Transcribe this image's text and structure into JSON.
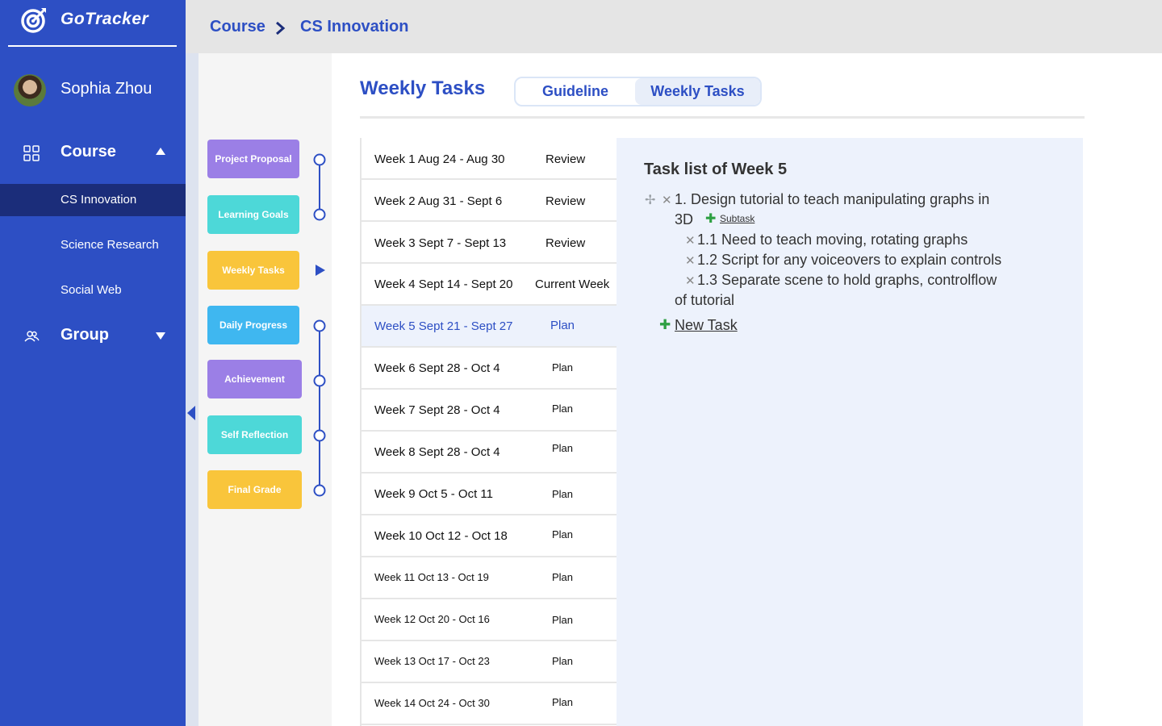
{
  "app": {
    "name": "GoTracker"
  },
  "user": {
    "name": "Sophia Zhou"
  },
  "sidebar": {
    "course": {
      "label": "Course"
    },
    "course_items": [
      "CS Innovation",
      "Science Research",
      "Social Web"
    ],
    "group": {
      "label": "Group"
    }
  },
  "breadcrumb": {
    "items": [
      "Course",
      "CS Innovation"
    ]
  },
  "stages": [
    {
      "label": "Project Proposal",
      "color": "#9b7fe6"
    },
    {
      "label": "Learning Goals",
      "color": "#4dd8d8"
    },
    {
      "label": "Weekly Tasks",
      "color": "#f9c53b"
    },
    {
      "label": "Daily Progress",
      "color": "#3fb7f0"
    },
    {
      "label": "Achievement",
      "color": "#9b7fe6"
    },
    {
      "label": "Self Reflection",
      "color": "#4dd8d8"
    },
    {
      "label": "Final Grade",
      "color": "#f9c53b"
    }
  ],
  "main": {
    "title": "Weekly Tasks",
    "tabs": [
      "Guideline",
      "Weekly Tasks"
    ]
  },
  "weeks": [
    {
      "label": "Week 1  Aug 24 - Aug 30",
      "status": "Review"
    },
    {
      "label": "Week 2  Aug 31 - Sept 6",
      "status": "Review"
    },
    {
      "label": "Week 3  Sept 7 - Sept 13",
      "status": "Review"
    },
    {
      "label": "Week 4  Sept 14 - Sept 20",
      "status": "Current Week"
    },
    {
      "label": "Week 5  Sept 21 - Sept 27",
      "status": "Plan"
    },
    {
      "label": "Week 6  Sept 28 - Oct 4",
      "status": "Plan"
    },
    {
      "label": "Week 7  Sept 28 - Oct 4",
      "status": "Plan"
    },
    {
      "label": "Week 8  Sept 28 - Oct 4",
      "status": "Plan"
    },
    {
      "label": "Week 9  Oct 5 - Oct 11",
      "status": "Plan"
    },
    {
      "label": "Week 10  Oct 12 - Oct 18",
      "status": "Plan"
    },
    {
      "label": "Week 11  Oct 13 - Oct 19",
      "status": "Plan"
    },
    {
      "label": "Week 12  Oct 20 - Oct 16",
      "status": "Plan"
    },
    {
      "label": "Week 13  Oct 17 - Oct 23",
      "status": "Plan"
    },
    {
      "label": "Week 14  Oct 24 - Oct 30",
      "status": "Plan"
    }
  ],
  "task_panel": {
    "title": "Task list of Week 5",
    "task1_line1": "1. Design tutorial to teach manipulating graphs in",
    "task1_line2": "3D",
    "subtask_link": "Subtask",
    "sub1": "1.1 Need to teach moving, rotating graphs",
    "sub2": "1.2 Script for any voiceovers to explain controls",
    "sub3_line1": "1.3 Separate scene to hold graphs, controlflow",
    "sub3_line2": "of tutorial",
    "new_task": "New Task"
  },
  "colors": {
    "primary": "#2d4fc4",
    "dark_active": "#1b2d7a",
    "green": "#2ea043"
  }
}
